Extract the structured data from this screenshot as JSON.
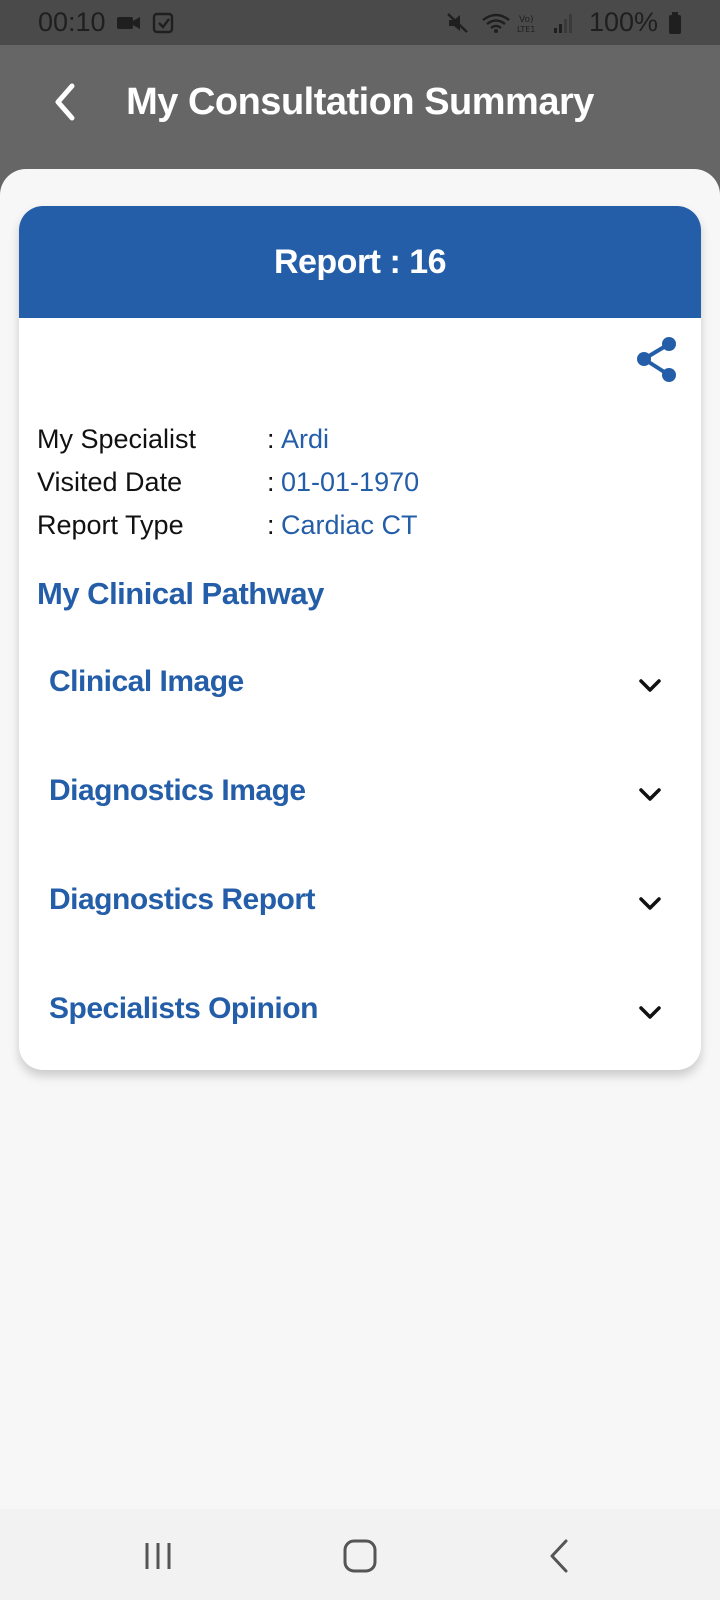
{
  "status_bar": {
    "time": "00:10",
    "battery": "100%",
    "icons": [
      "video-camera-icon",
      "clipboard-check-icon",
      "mute-icon",
      "wifi-icon",
      "volte-icon",
      "signal-icon",
      "battery-icon"
    ]
  },
  "header": {
    "title": "My Consultation Summary",
    "back_icon": "chevron-left-icon"
  },
  "report": {
    "title": "Report : 16",
    "share_icon": "share-icon",
    "fields": [
      {
        "label": "My Specialist",
        "separator": ":",
        "value": "Ardi"
      },
      {
        "label": "Visited Date",
        "separator": ":",
        "value": "01-01-1970"
      },
      {
        "label": "Report Type",
        "separator": ":",
        "value": "Cardiac CT"
      }
    ],
    "pathway_title": "My Clinical Pathway",
    "sections": [
      {
        "label": "Clinical Image"
      },
      {
        "label": "Diagnostics Image"
      },
      {
        "label": "Diagnostics Report"
      },
      {
        "label": "Specialists Opinion"
      }
    ]
  },
  "nav_bar": {
    "buttons": [
      "recent-apps-icon",
      "home-icon",
      "back-icon"
    ]
  },
  "colors": {
    "accent": "#245ea9",
    "header_bg": "#666666",
    "status_bg": "#4a4a4a",
    "content_bg": "#f7f7f7"
  }
}
